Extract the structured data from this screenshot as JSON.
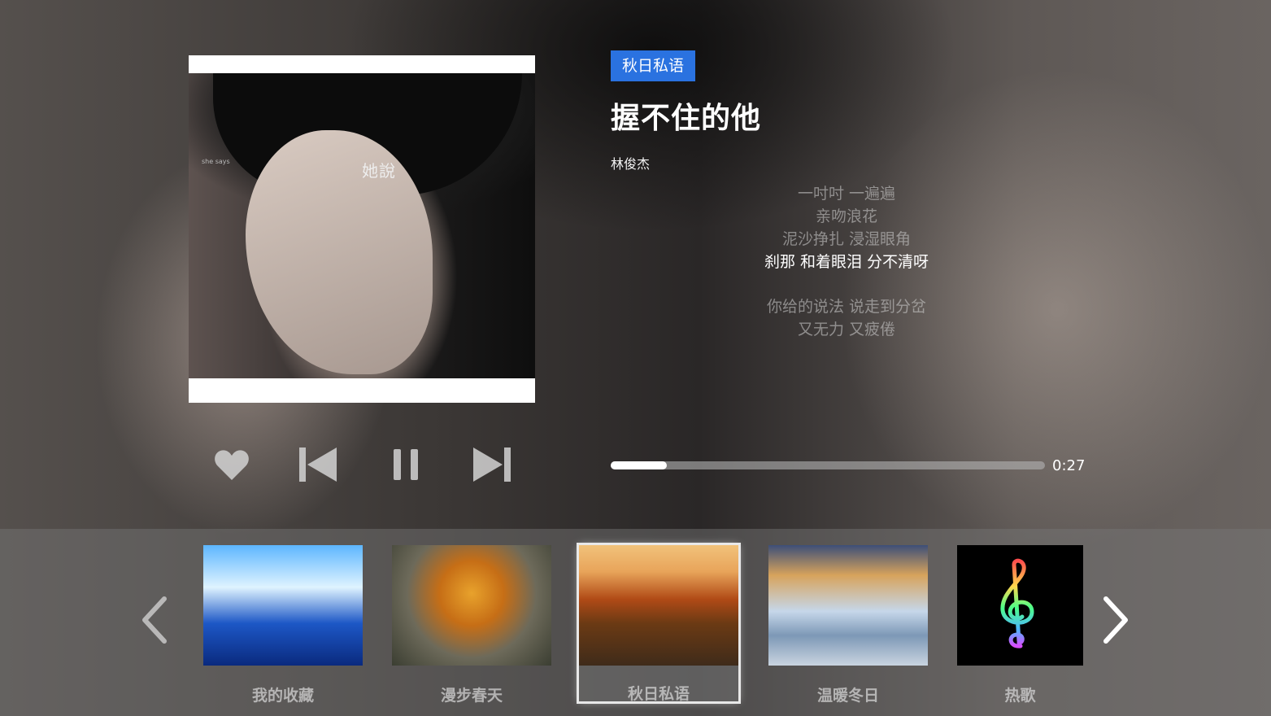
{
  "playlist_tag": "秋日私语",
  "song": {
    "title": "握不住的他",
    "artist": "林俊杰",
    "cover_title": "她說",
    "cover_subtitle": "she says"
  },
  "lyrics": [
    {
      "text": "一吋吋 一遍遍",
      "active": false
    },
    {
      "text": "亲吻浪花",
      "active": false
    },
    {
      "text": "泥沙挣扎 浸湿眼角",
      "active": false
    },
    {
      "text": "刹那 和着眼泪 分不清呀",
      "active": true
    },
    {
      "text": "你给的说法 说走到分岔",
      "active": false
    },
    {
      "text": "又无力 又疲倦",
      "active": false
    }
  ],
  "controls": {
    "like_icon": "heart-icon",
    "prev_icon": "skip-previous-icon",
    "pause_icon": "pause-icon",
    "next_icon": "skip-next-icon"
  },
  "progress": {
    "current_time": "0:27",
    "fraction": 0.13
  },
  "playlists": [
    {
      "label": "我的收藏",
      "active": false
    },
    {
      "label": "漫步春天",
      "active": false
    },
    {
      "label": "秋日私语",
      "active": true
    },
    {
      "label": "温暖冬日",
      "active": false
    },
    {
      "label": "热歌",
      "active": false
    }
  ],
  "colors": {
    "accent": "#2a72e0",
    "progress_fill": "#ffffff",
    "progress_track": "#b4b4b4"
  }
}
